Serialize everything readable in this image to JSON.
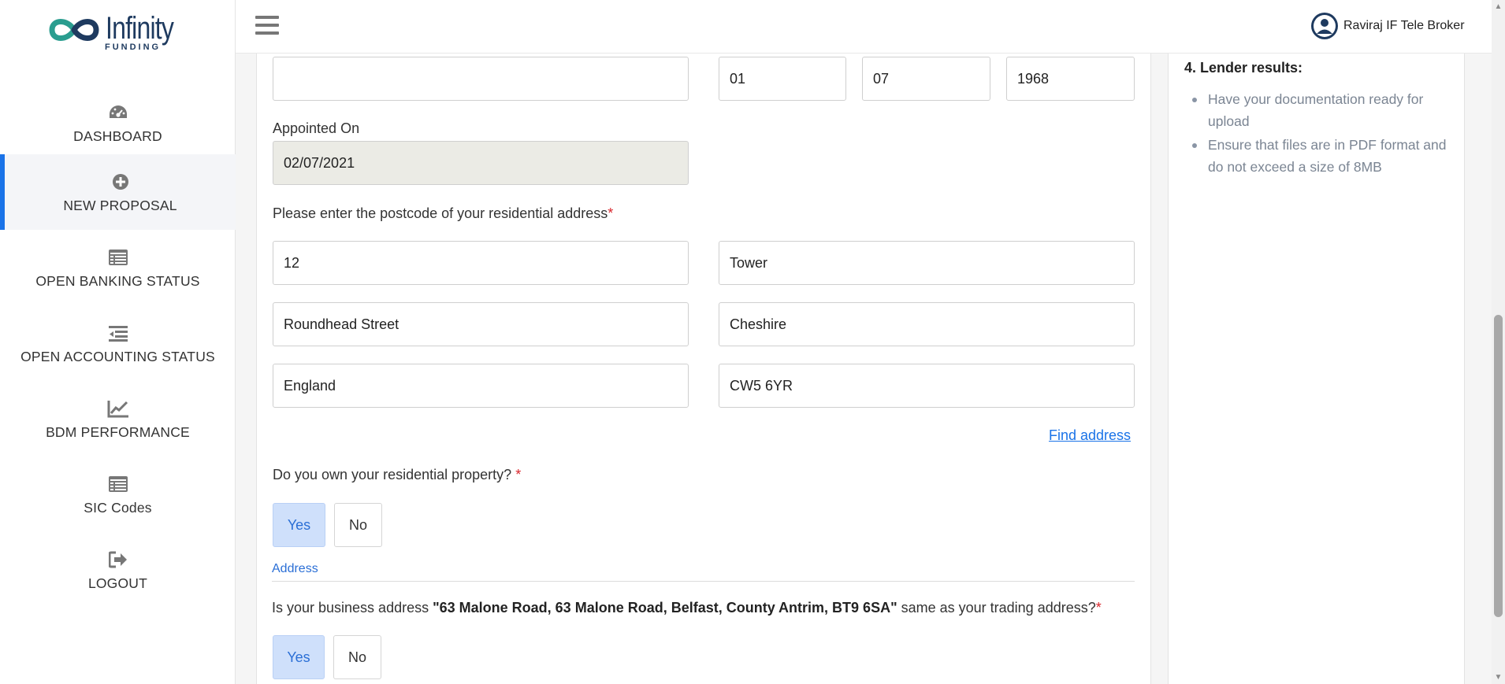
{
  "brand": {
    "name": "Infinity",
    "sub": "FUNDING"
  },
  "topbar": {
    "user_name": "Raviraj IF Tele Broker"
  },
  "sidebar": {
    "items": [
      {
        "label": "DASHBOARD",
        "icon": "dashboard-icon"
      },
      {
        "label": "NEW PROPOSAL",
        "icon": "plus-circle-icon"
      },
      {
        "label": "OPEN BANKING STATUS",
        "icon": "list-card-icon"
      },
      {
        "label": "OPEN ACCOUNTING STATUS",
        "icon": "indent-list-icon"
      },
      {
        "label": "BDM PERFORMANCE",
        "icon": "line-chart-icon"
      },
      {
        "label": "SIC Codes",
        "icon": "list-card-icon"
      },
      {
        "label": "LOGOUT",
        "icon": "logout-icon"
      }
    ],
    "active_index": 1
  },
  "form": {
    "name_field_value": "",
    "dob_day": "01",
    "dob_month": "07",
    "dob_year": "1968",
    "appointed_on_label": "Appointed On",
    "appointed_on_value": "02/07/2021",
    "postcode_question": "Please enter the postcode of your residential address",
    "address_line1": "12",
    "address_line2": "Tower",
    "street": "Roundhead Street",
    "county": "Cheshire",
    "country": "England",
    "postcode": "CW5 6YR",
    "find_address_label": "Find address",
    "own_property_question": "Do you own your residential property?",
    "own_property_yes": "Yes",
    "own_property_no": "No",
    "address_section_title": "Address",
    "business_q_prefix": "Is your business address ",
    "business_q_address": "\"63 Malone Road, 63 Malone Road, Belfast, County Antrim, BT9 6SA\"",
    "business_q_suffix": " same as your trading address?",
    "business_yes": "Yes",
    "business_no": "No"
  },
  "side_panel": {
    "heading": "4. Lender results:",
    "items": [
      "Have your documentation ready for upload",
      "Ensure that files are in PDF format and do not exceed a size of 8MB"
    ]
  },
  "colors": {
    "accent": "#1a73e8",
    "selected_bg": "#cfe0fb",
    "required": "#d9262c",
    "brand_navy": "#1e3a5f",
    "brand_teal": "#2a9d8f"
  }
}
